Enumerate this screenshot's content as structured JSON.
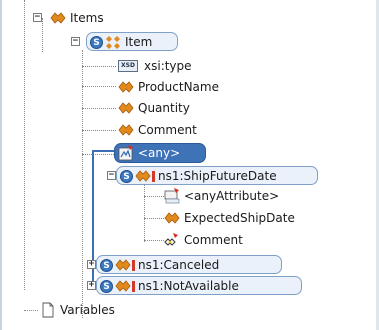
{
  "tree": {
    "items_label": "Items",
    "item_label": "Item",
    "xsi_type_label": "xsi:type",
    "xsd_badge": "XSD",
    "product_name_label": "ProductName",
    "quantity_label": "Quantity",
    "comment_label": "Comment",
    "any_label": "<any>",
    "ship_future_date_label": "ns1:ShipFutureDate",
    "any_attribute_label": "<anyAttribute>",
    "expected_ship_date_label": "ExpectedShipDate",
    "comment2_label": "Comment",
    "canceled_label": "ns1:Canceled",
    "not_available_label": "ns1:NotAvailable",
    "variables_label": "Variables",
    "schema_badge": "S",
    "expand_symbol": "+",
    "collapse_symbol": "−"
  },
  "colors": {
    "selection": "#3e73b8",
    "element_icon": "#e08a1e",
    "schema_icon": "#3a78c2",
    "highlight_line": "#3a6fb3"
  }
}
